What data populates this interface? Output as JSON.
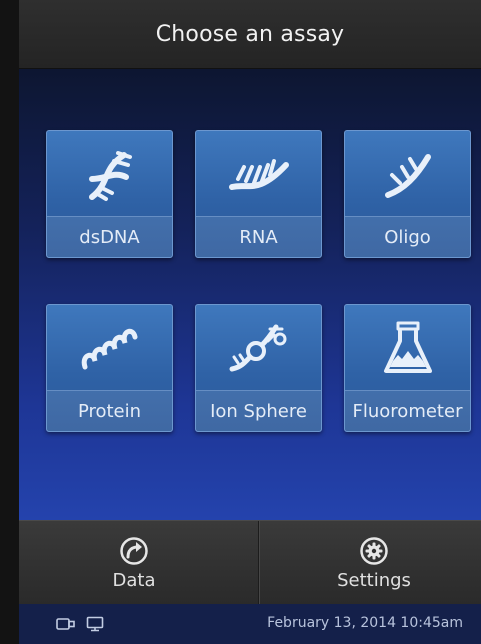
{
  "header": {
    "title": "Choose an assay"
  },
  "assays": [
    {
      "label": "dsDNA",
      "icon": "dsdna-helix-icon"
    },
    {
      "label": "RNA",
      "icon": "rna-strand-icon"
    },
    {
      "label": "Oligo",
      "icon": "oligo-strand-icon"
    },
    {
      "label": "Protein",
      "icon": "protein-coil-icon"
    },
    {
      "label": "Ion Sphere",
      "icon": "ion-sphere-icon"
    },
    {
      "label": "Fluorometer",
      "icon": "fluorometer-flask-icon"
    }
  ],
  "bottom_nav": {
    "data_label": "Data",
    "data_icon": "share-arrow-icon",
    "settings_label": "Settings",
    "settings_icon": "gear-icon"
  },
  "status_bar": {
    "datetime": "February 13, 2014 10:45am",
    "icons": [
      "usb-drive-icon",
      "computer-monitor-icon"
    ]
  },
  "colors": {
    "background_top": "#0d1631",
    "background_bottom": "#2443ad",
    "tile": "#3f78bd",
    "header": "#2a2a2a"
  }
}
